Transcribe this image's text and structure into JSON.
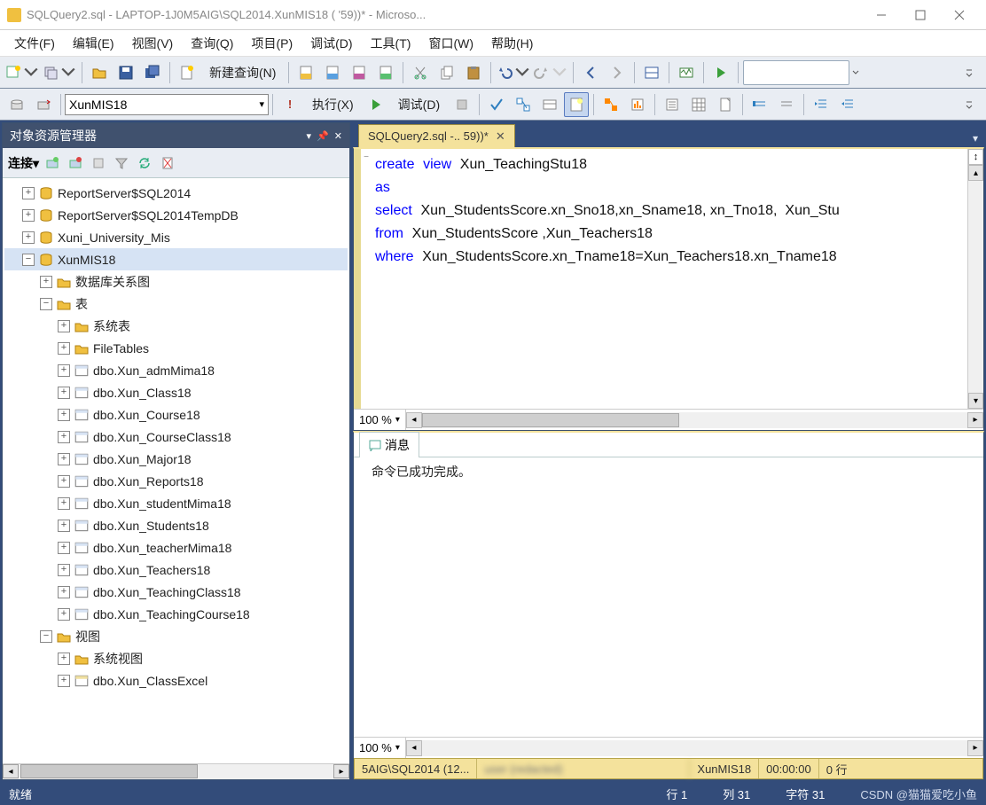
{
  "title_bar": {
    "text": "SQLQuery2.sql - LAPTOP-1J0M5AIG\\SQL2014.XunMIS18 (                         '59))* - Microso..."
  },
  "menu": {
    "items": [
      "文件(F)",
      "编辑(E)",
      "视图(V)",
      "查询(Q)",
      "项目(P)",
      "调试(D)",
      "工具(T)",
      "窗口(W)",
      "帮助(H)"
    ]
  },
  "toolbar1": {
    "new_query": "新建查询(N)"
  },
  "toolbar2": {
    "db_selected": "XunMIS18",
    "execute": "执行(X)",
    "debug": "调试(D)"
  },
  "object_explorer": {
    "title": "对象资源管理器",
    "connect": "连接",
    "tree": {
      "root_dbs": [
        "ReportServer$SQL2014",
        "ReportServer$SQL2014TempDB",
        "Xuni_University_Mis"
      ],
      "current_db": "XunMIS18",
      "folder_diagrams": "数据库关系图",
      "folder_tables": "表",
      "folder_systables": "系统表",
      "folder_filetables": "FileTables",
      "tables": [
        "dbo.Xun_admMima18",
        "dbo.Xun_Class18",
        "dbo.Xun_Course18",
        "dbo.Xun_CourseClass18",
        "dbo.Xun_Major18",
        "dbo.Xun_Reports18",
        "dbo.Xun_studentMima18",
        "dbo.Xun_Students18",
        "dbo.Xun_teacherMima18",
        "dbo.Xun_Teachers18",
        "dbo.Xun_TeachingClass18",
        "dbo.Xun_TeachingCourse18"
      ],
      "folder_views": "视图",
      "folder_sysviews": "系统视图",
      "views": [
        "dbo.Xun_ClassExcel"
      ]
    }
  },
  "editor": {
    "tab_title": "SQLQuery2.sql -..                       59))*",
    "zoom": "100 %",
    "sql": {
      "l1_kw1": "create",
      "l1_kw2": "view",
      "l1_obj": "Xun_TeachingStu18",
      "l2_kw": "as",
      "l3_kw": "select",
      "l3_rest": "Xun_StudentsScore.xn_Sno18,xn_Sname18, xn_Tno18,  Xun_Stu",
      "l4_kw": "from",
      "l4_rest": "Xun_StudentsScore ,Xun_Teachers18",
      "l5_kw": "where",
      "l5_rest": "Xun_StudentsScore.xn_Tname18=Xun_Teachers18.xn_Tname18"
    }
  },
  "messages": {
    "tab": "消息",
    "text": "命令已成功完成。",
    "zoom": "100 %"
  },
  "conn_status": {
    "server": "5AIG\\SQL2014 (12...",
    "db": "XunMIS18",
    "elapsed": "00:00:00",
    "rows": "0 行"
  },
  "status": {
    "ready": "就绪",
    "line": "行 1",
    "col": "列 31",
    "char": "字符 31",
    "watermark": "CSDN @猫猫爱吃小鱼"
  }
}
